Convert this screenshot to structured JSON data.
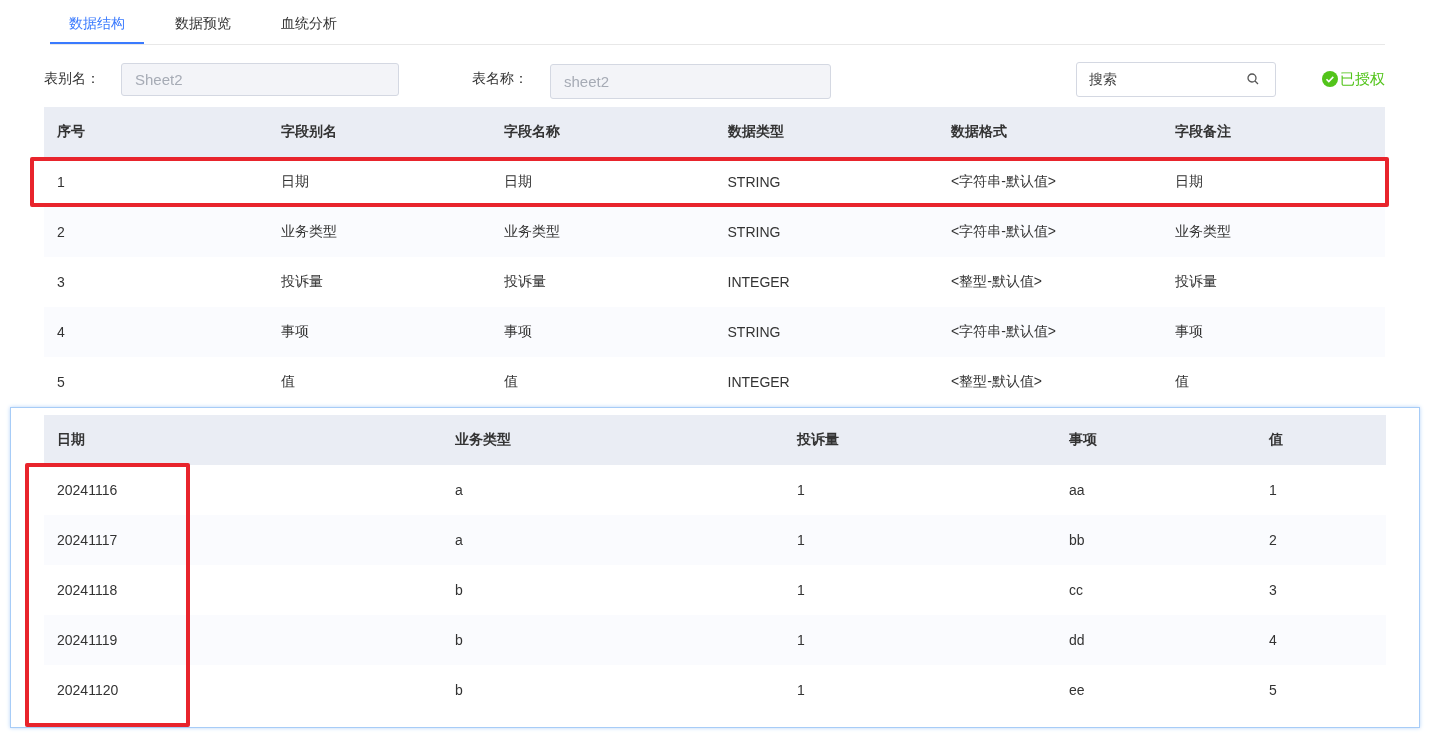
{
  "tabs": [
    {
      "label": "数据结构",
      "selected": true
    },
    {
      "label": "数据预览",
      "selected": false
    },
    {
      "label": "血统分析",
      "selected": false
    }
  ],
  "form": {
    "alias_label": "表别名：",
    "alias_value": "Sheet2",
    "name_label": "表名称：",
    "name_value": "sheet2",
    "search": {
      "placeholder": "搜索"
    },
    "status": "已授权"
  },
  "structure_table": {
    "columns": [
      "序号",
      "字段别名",
      "字段名称",
      "数据类型",
      "数据格式",
      "字段备注"
    ],
    "rows": [
      {
        "cells": [
          "1",
          "日期",
          "日期",
          "STRING",
          "<字符串-默认值>",
          "日期"
        ],
        "marked": true
      },
      {
        "cells": [
          "2",
          "业务类型",
          "业务类型",
          "STRING",
          "<字符串-默认值>",
          "业务类型"
        ],
        "marked": false
      },
      {
        "cells": [
          "3",
          "投诉量",
          "投诉量",
          "INTEGER",
          "<整型-默认值>",
          "投诉量"
        ],
        "marked": false
      },
      {
        "cells": [
          "4",
          "事项",
          "事项",
          "STRING",
          "<字符串-默认值>",
          "事项"
        ],
        "marked": false
      },
      {
        "cells": [
          "5",
          "值",
          "值",
          "INTEGER",
          "<整型-默认值>",
          "值"
        ],
        "marked": false
      }
    ]
  },
  "preview_table": {
    "columns": [
      {
        "label": "日期",
        "marked": true
      },
      {
        "label": "业务类型",
        "marked": false
      },
      {
        "label": "投诉量",
        "marked": false
      },
      {
        "label": "事项",
        "marked": false
      },
      {
        "label": "值",
        "marked": false
      }
    ],
    "rows": [
      [
        "20241116",
        "a",
        "1",
        "aa",
        "1"
      ],
      [
        "20241117",
        "a",
        "1",
        "bb",
        "2"
      ],
      [
        "20241118",
        "b",
        "1",
        "cc",
        "3"
      ],
      [
        "20241119",
        "b",
        "1",
        "dd",
        "4"
      ],
      [
        "20241120",
        "b",
        "1",
        "ee",
        "5"
      ]
    ]
  }
}
